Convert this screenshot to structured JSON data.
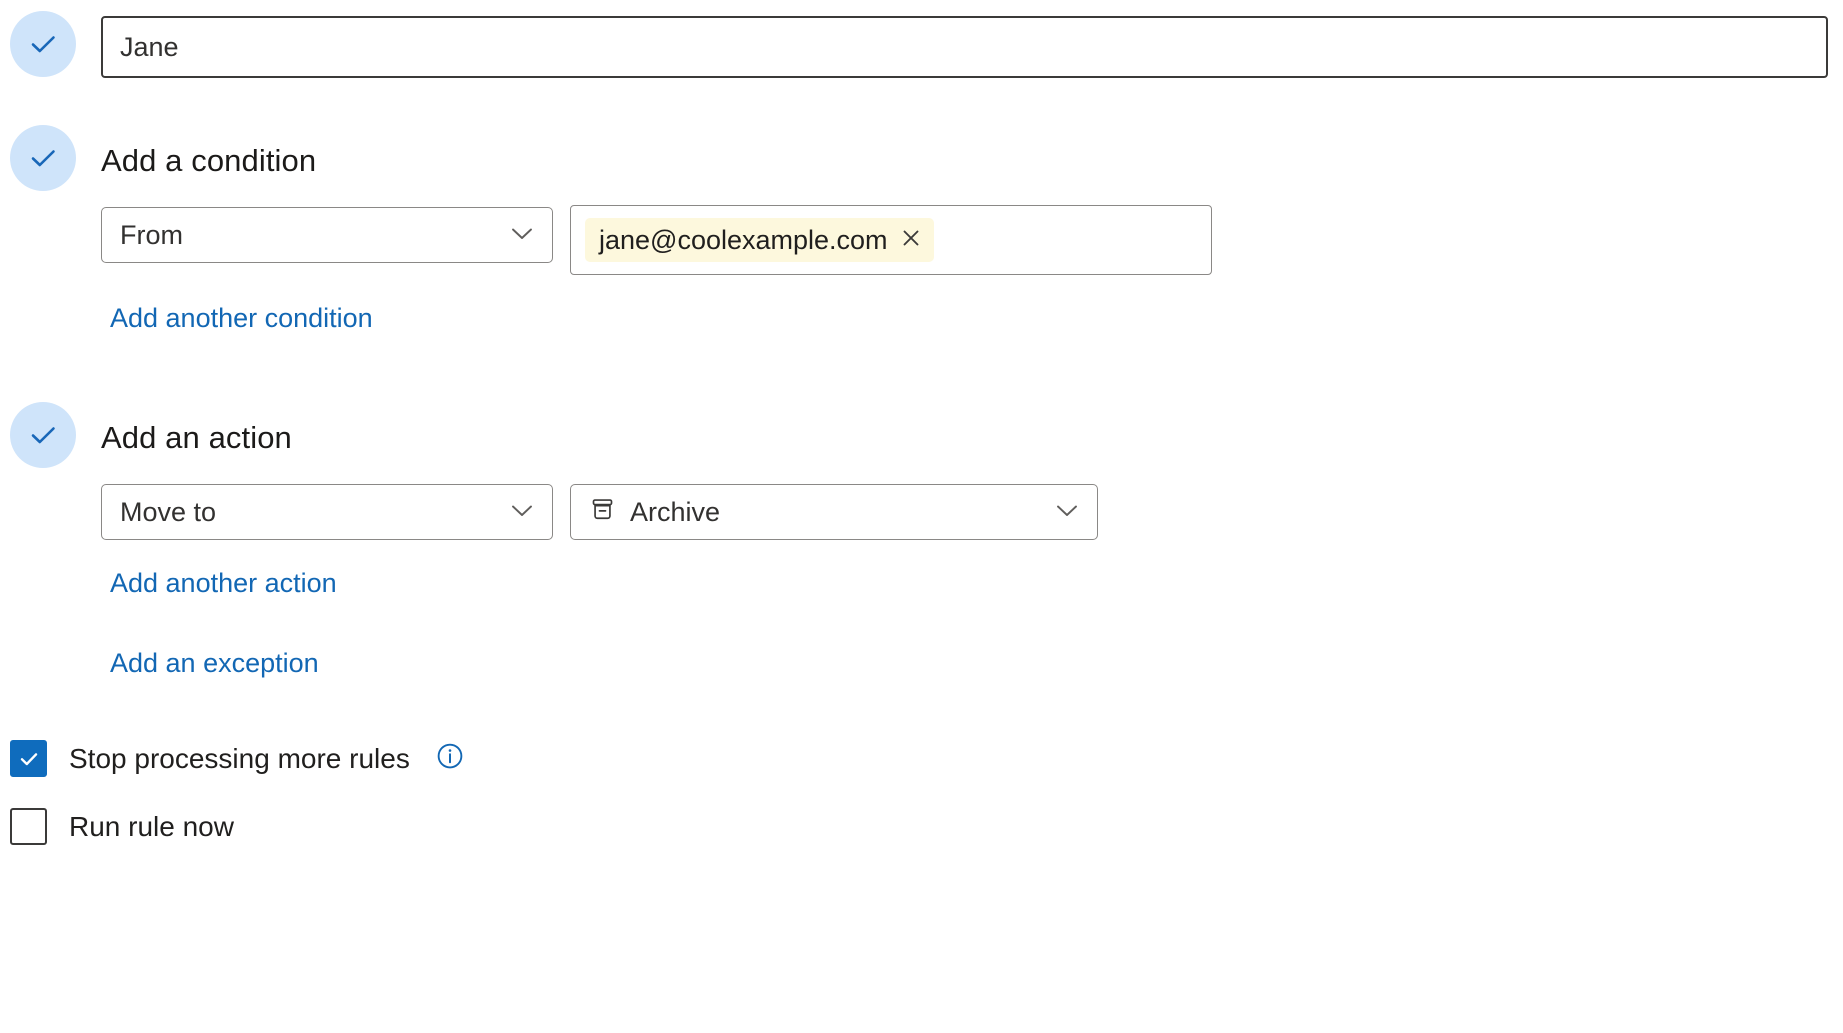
{
  "rule": {
    "name_field": {
      "value": "Jane",
      "placeholder": "Name"
    },
    "condition_section": {
      "title": "Add a condition",
      "condition_type": "From",
      "recipients": [
        {
          "text": "jane@coolexample.com"
        }
      ],
      "add_another_link": "Add another condition"
    },
    "action_section": {
      "title": "Add an action",
      "action_type": "Move to",
      "action_target": "Archive",
      "action_target_icon": "archive-icon",
      "add_another_link": "Add another action",
      "add_exception_link": "Add an exception"
    },
    "options": [
      {
        "label": "Stop processing more rules",
        "checked": true,
        "has_info": true,
        "info_icon": "info-circle-icon"
      },
      {
        "label": "Run rule now",
        "checked": false,
        "has_info": false
      }
    ]
  },
  "icons": {
    "step_complete": "check-circle-icon",
    "chevron": "chevron-down-icon",
    "token_remove": "close-icon"
  },
  "colors": {
    "accent_blue": "#0f6cbd",
    "link_blue": "#1267b4",
    "bullet_bg": "#cfe4fa",
    "token_bg": "#fdf8dd",
    "token_border": "#f0c929",
    "field_border": "#8a8886",
    "focused_border": "#3b3a39"
  }
}
